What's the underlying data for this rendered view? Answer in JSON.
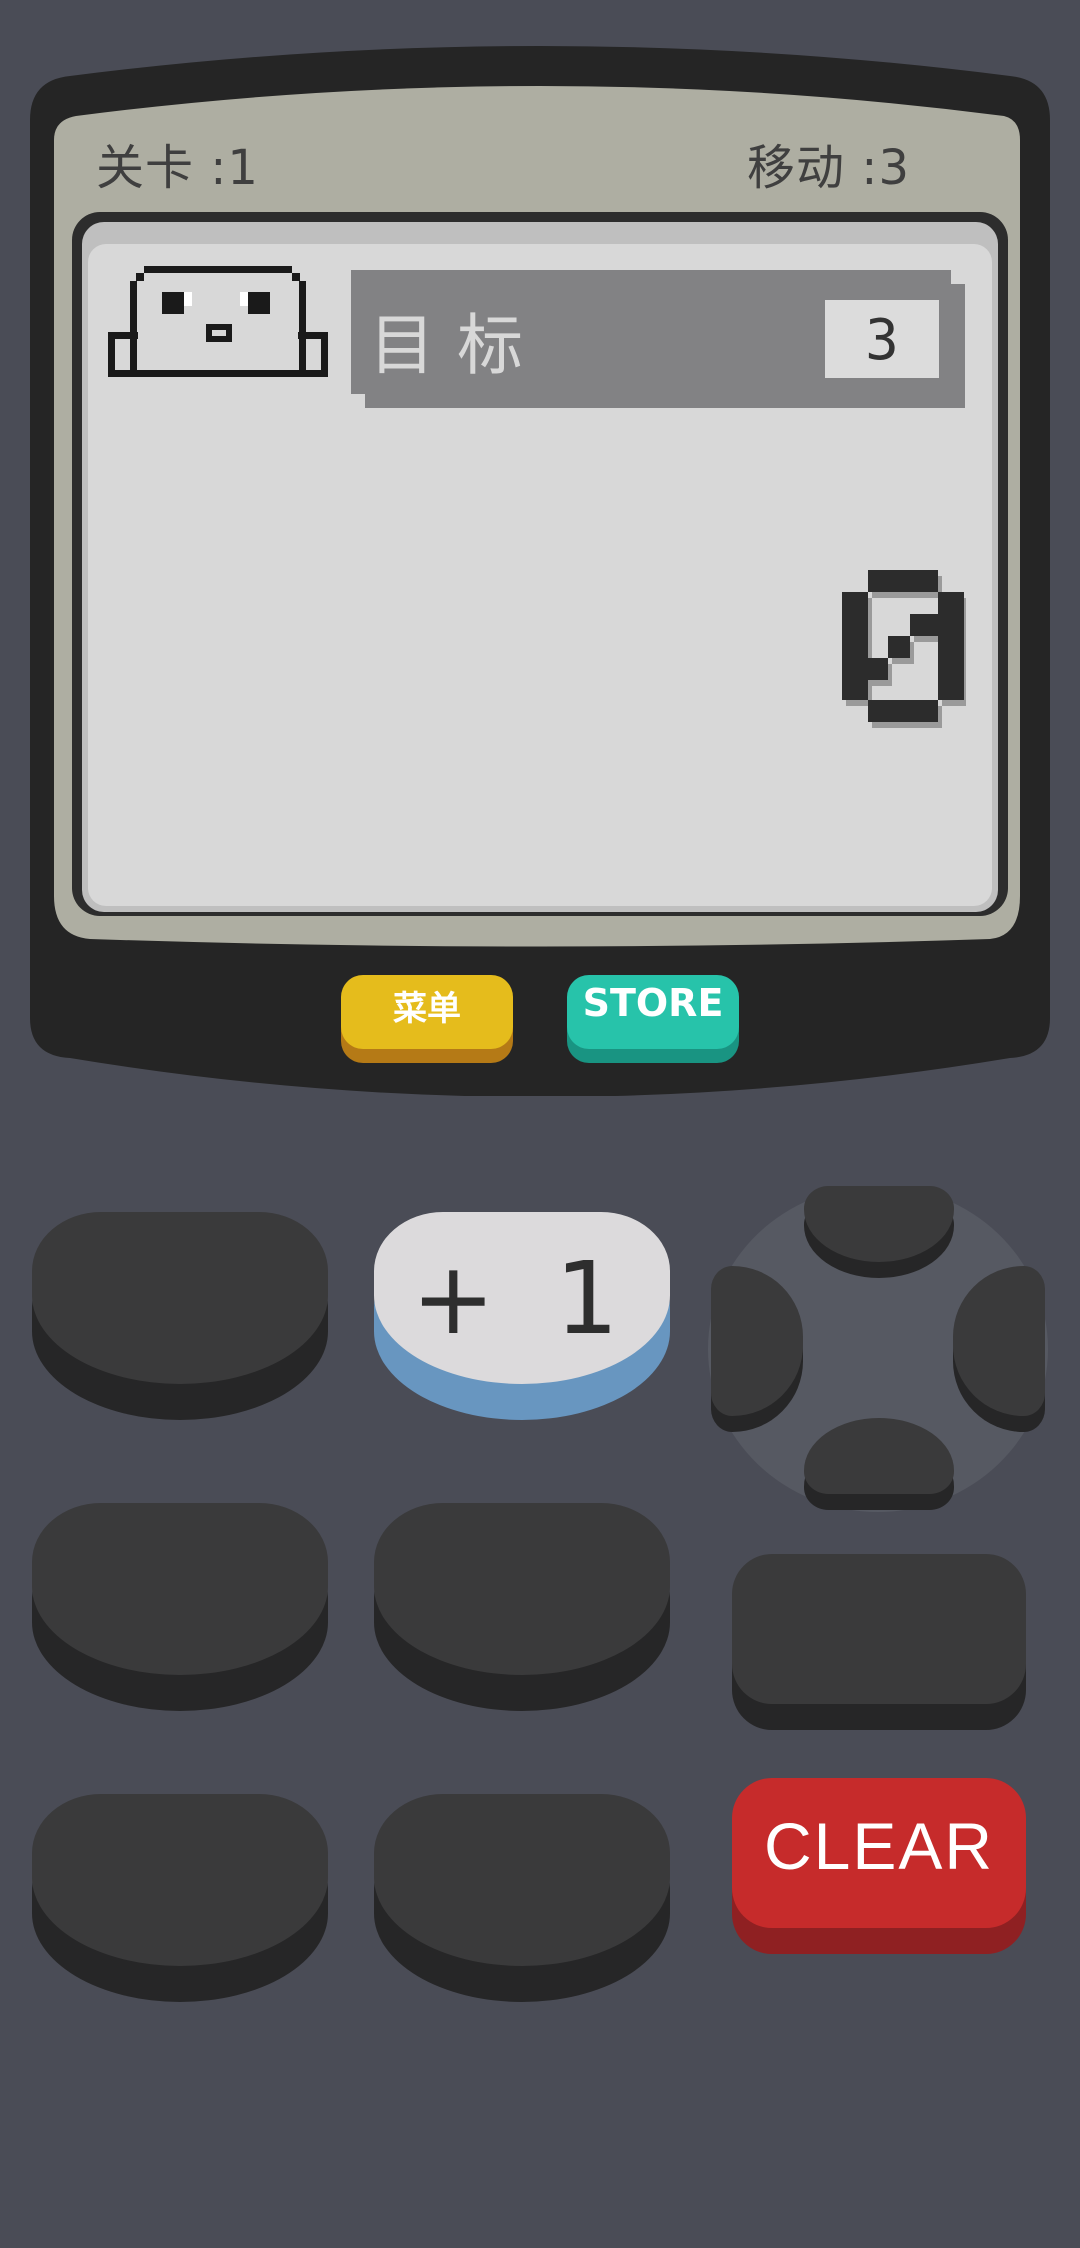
{
  "header": {
    "level_text": "关卡 :1",
    "moves_text": "移动 :3"
  },
  "display": {
    "goal_label": "目标",
    "goal_value": "3",
    "current_value": 0
  },
  "buttons": {
    "menu_label": "菜单",
    "store_label": "STORE",
    "plus_one_label": "+ 1",
    "clear_label": "CLEAR"
  },
  "colors": {
    "background": "#4a4c56",
    "screen": "#d8d8d8",
    "menu_button": "#e5bc1c",
    "store_button": "#27c3aa",
    "clear_button": "#c62b2b",
    "plus_one_button": "#dcdadc"
  }
}
